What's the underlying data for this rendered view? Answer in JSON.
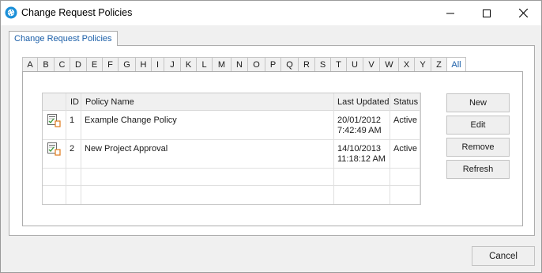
{
  "window": {
    "title": "Change Request Policies",
    "icon": "app-logo-icon",
    "controls": [
      "minimize-icon",
      "maximize-icon",
      "close-icon"
    ]
  },
  "outer_tab": {
    "label": "Change Request Policies"
  },
  "letter_tabs": [
    "A",
    "B",
    "C",
    "D",
    "E",
    "F",
    "G",
    "H",
    "I",
    "J",
    "K",
    "L",
    "M",
    "N",
    "O",
    "P",
    "Q",
    "R",
    "S",
    "T",
    "U",
    "V",
    "W",
    "X",
    "Y",
    "Z",
    "All"
  ],
  "active_letter": "All",
  "grid": {
    "columns": [
      "",
      "ID",
      "Policy Name",
      "Last Updated",
      "Status"
    ],
    "rows": [
      {
        "icon": "policy-icon",
        "id": "1",
        "name": "Example Change Policy",
        "updated_date": "20/01/2012",
        "updated_time": "7:42:49 AM",
        "status": "Active"
      },
      {
        "icon": "policy-icon",
        "id": "2",
        "name": "New Project Approval",
        "updated_date": "14/10/2013",
        "updated_time": "11:18:12 AM",
        "status": "Active"
      }
    ]
  },
  "actions": {
    "new": "New",
    "edit": "Edit",
    "remove": "Remove",
    "refresh": "Refresh"
  },
  "footer": {
    "cancel": "Cancel"
  },
  "colors": {
    "accent": "#1a5ea8",
    "border": "#adadad",
    "background": "#f0f0f0"
  }
}
